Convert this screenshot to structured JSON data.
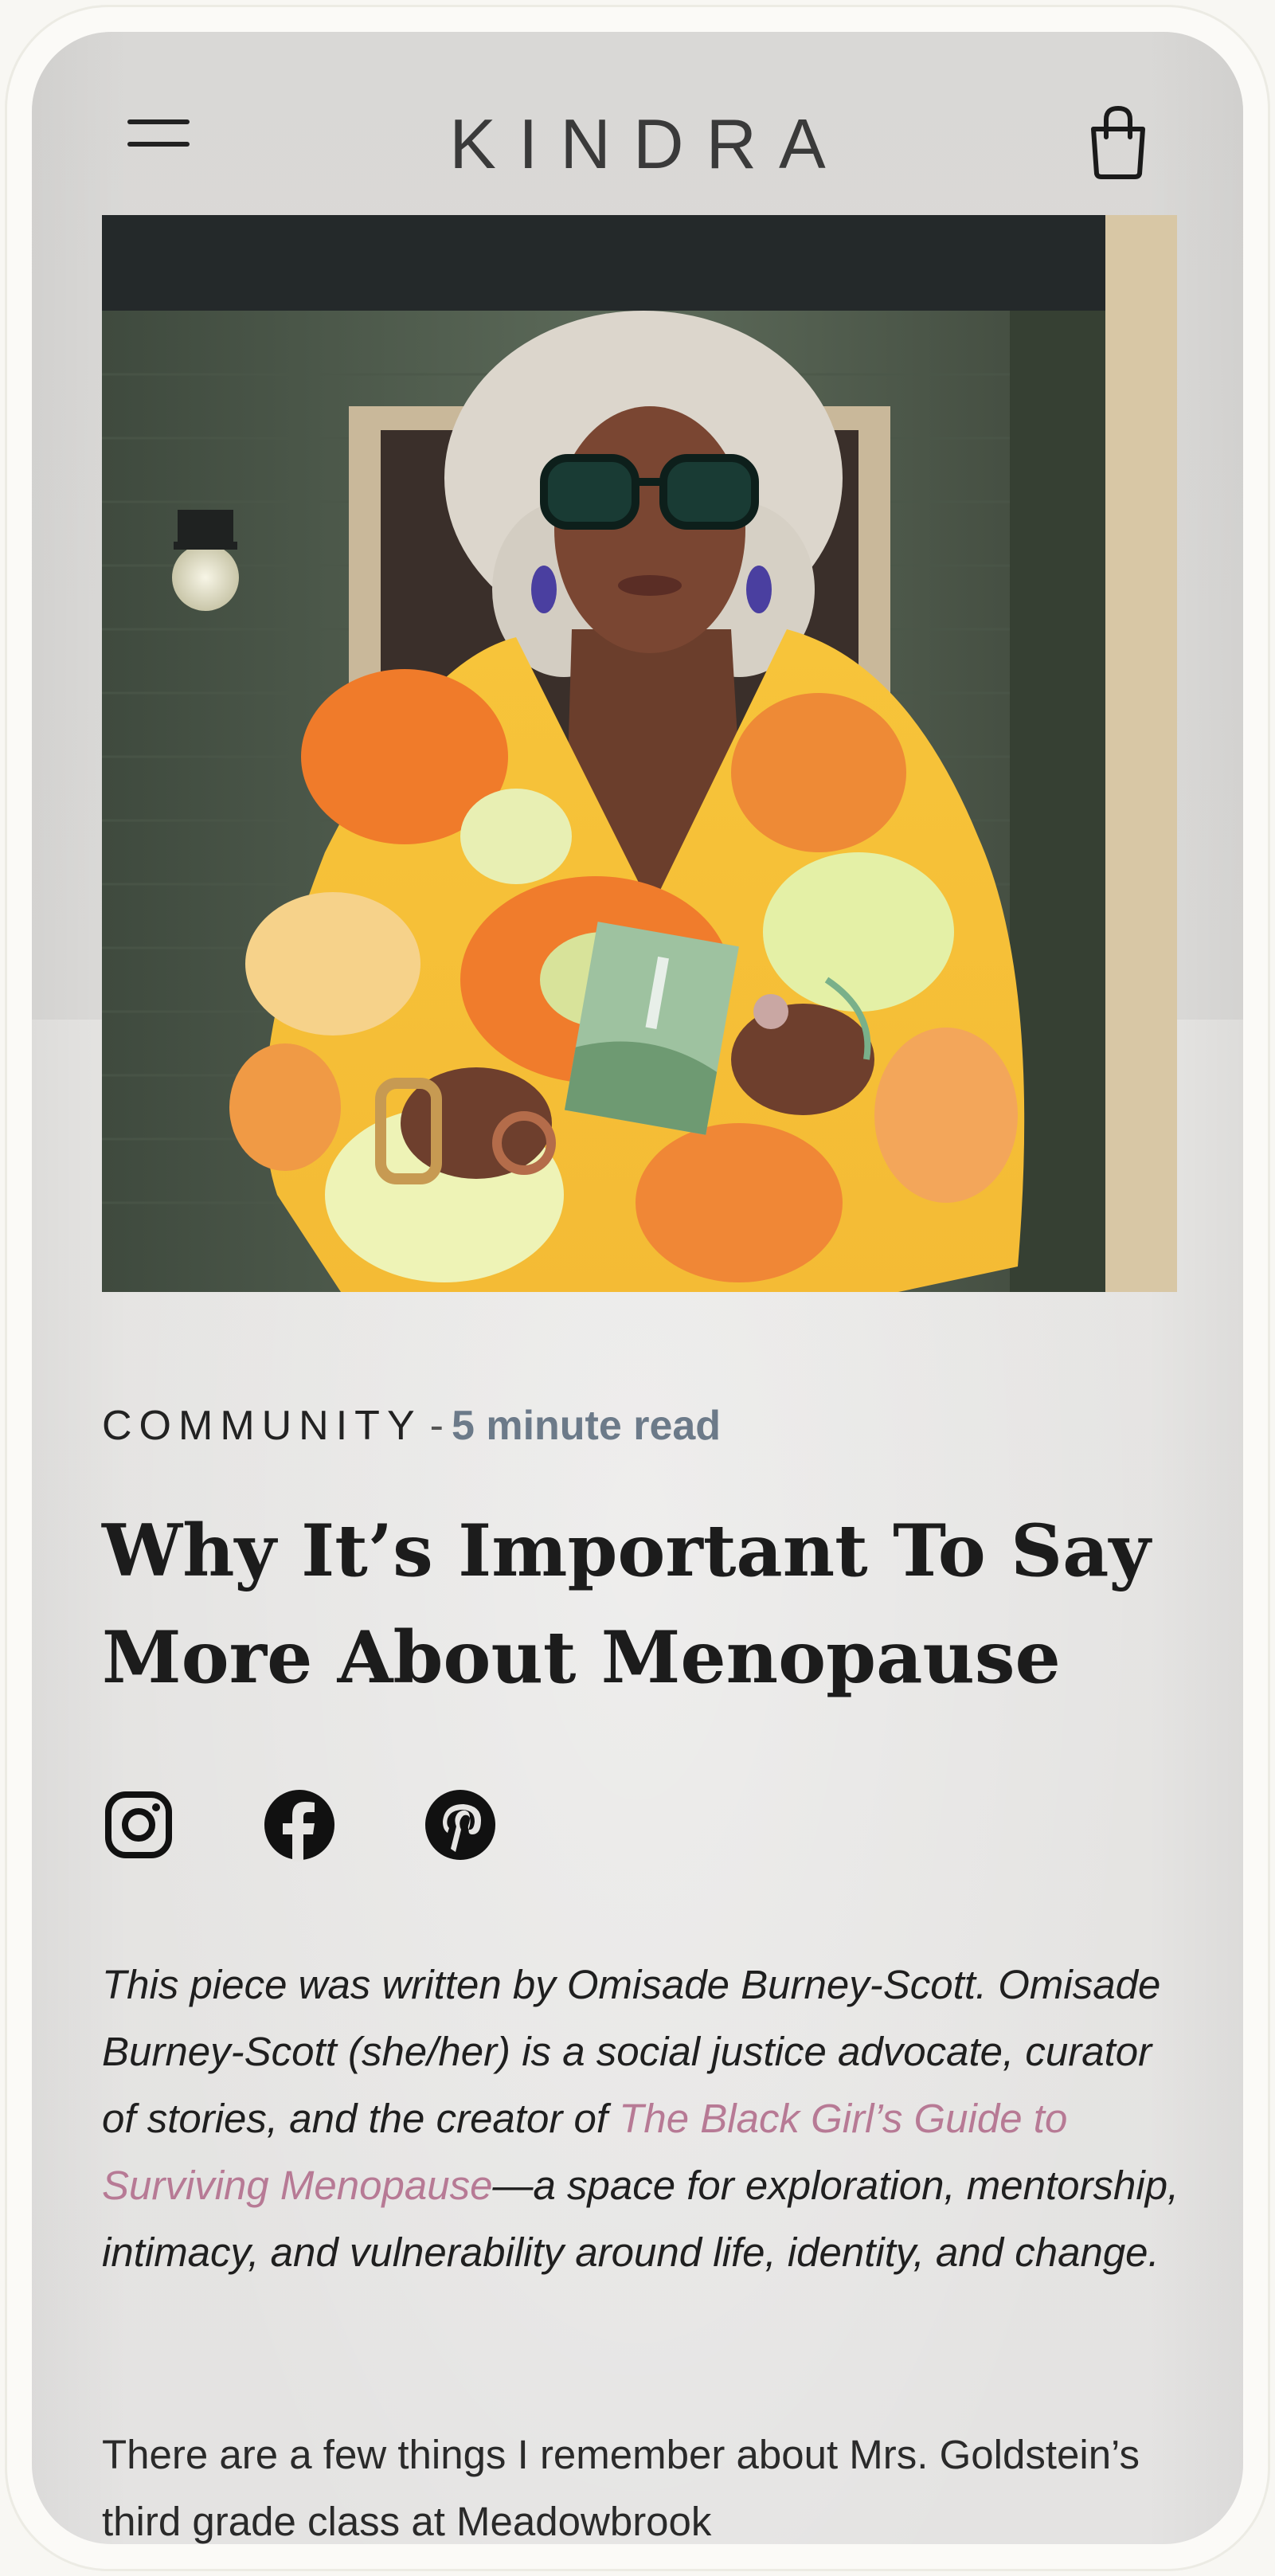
{
  "header": {
    "brand": "KINDRA",
    "menu_icon": "hamburger-menu-icon",
    "cart_icon": "shopping-bag-icon"
  },
  "hero": {
    "alt": "Woman with silver curly hair and green glasses wearing an orange floral dress holding a card"
  },
  "article": {
    "category": "COMMUNITY",
    "separator": "-",
    "read_time": "5 minute read",
    "title": "Why It’s Important To Say More About Menopause",
    "share_icons": [
      "instagram-icon",
      "facebook-icon",
      "pinterest-icon"
    ],
    "intro_before_link": "This piece was written by Omisade Burney-Scott. Omisade Burney-Scott (she/her) is a social justice advocate, curator of stories, and the creator of ",
    "intro_link": "The Black Girl’s Guide to Surviving Menopause",
    "intro_after_link": "—a space for exploration, mentorship, intimacy, and vulnerability around life, identity, and change.",
    "body_paragraph": "There are a few things I remember about Mrs. Goldstein’s third grade class at Meadowbrook"
  },
  "colors": {
    "link": "#b77a95",
    "read_time": "#6c7a89",
    "text": "#1c1c1c"
  }
}
